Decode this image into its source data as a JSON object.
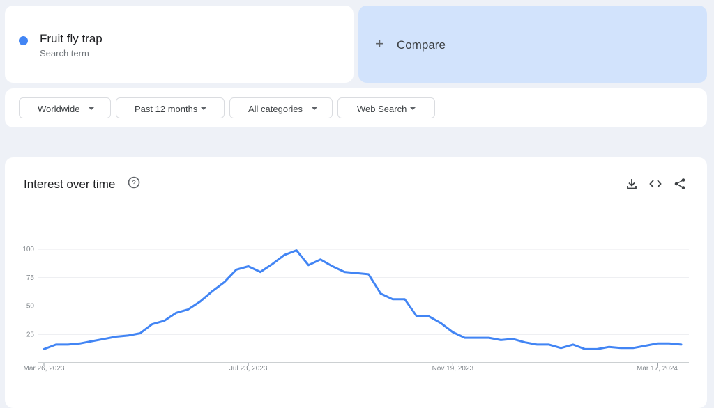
{
  "search_term": {
    "title": "Fruit fly trap",
    "subtitle": "Search term",
    "color": "#4285f4"
  },
  "compare": {
    "icon": "plus-icon",
    "label": "Compare",
    "background": "#d2e3fc"
  },
  "filters": [
    {
      "label": "Worldwide",
      "icon": "caret-down-icon"
    },
    {
      "label": "Past 12 months",
      "icon": "caret-down-icon"
    },
    {
      "label": "All categories",
      "icon": "caret-down-icon"
    },
    {
      "label": "Web Search",
      "icon": "caret-down-icon"
    }
  ],
  "interest_panel": {
    "title": "Interest over time",
    "help_icon": "help-circle-icon",
    "tools": [
      "download-icon",
      "embed-code-icon",
      "share-icon"
    ]
  },
  "chart_data": {
    "type": "line",
    "title": "",
    "xlabel": "",
    "ylabel": "",
    "ylim": [
      0,
      100
    ],
    "yticks": [
      25,
      50,
      75,
      100
    ],
    "grid": true,
    "x_tick_labels": [
      "Mar 26, 2023",
      "Jul 23, 2023",
      "Nov 19, 2023",
      "Mar 17, 2024"
    ],
    "x_tick_indices": [
      0,
      17,
      34,
      51
    ],
    "line_color": "#4285f4",
    "series": [
      {
        "values": [
          12,
          16,
          16,
          17,
          19,
          21,
          23,
          24,
          26,
          34,
          37,
          44,
          47,
          54,
          63,
          71,
          82,
          85,
          80,
          87,
          95,
          99,
          86,
          91,
          85,
          80,
          79,
          78,
          61,
          56,
          56,
          41,
          41,
          35,
          27,
          22,
          22,
          22,
          20,
          21,
          18,
          16,
          16,
          13,
          16,
          12,
          12,
          14,
          13,
          13,
          15,
          17,
          17,
          16
        ]
      }
    ]
  }
}
